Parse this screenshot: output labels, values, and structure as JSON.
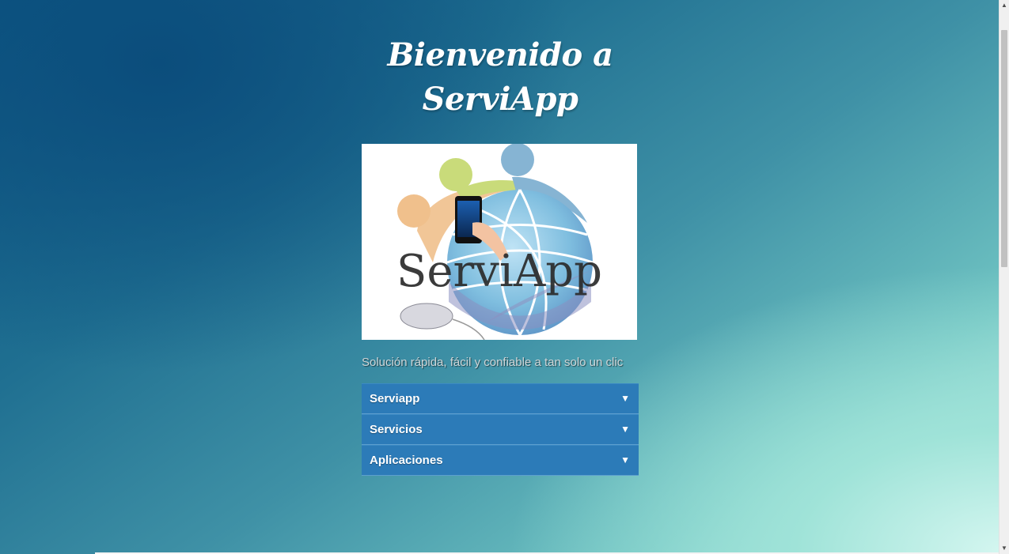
{
  "header": {
    "title_line1": "Bienvenido a",
    "title_line2": "ServiApp"
  },
  "logo": {
    "text": "ServiApp"
  },
  "tagline": "Solución rápida, fácil y confiable a tan solo un clic",
  "menu": {
    "items": [
      {
        "label": "Serviapp",
        "arrow": "▼"
      },
      {
        "label": "Servicios",
        "arrow": "▼"
      },
      {
        "label": "Aplicaciones",
        "arrow": "▼"
      }
    ]
  },
  "scrollbar": {
    "up": "▲",
    "down": "▼"
  },
  "colors": {
    "menu_bg": "#2c7bb8",
    "bg_dark": "#0d5683",
    "bg_light": "#b8eee6"
  }
}
